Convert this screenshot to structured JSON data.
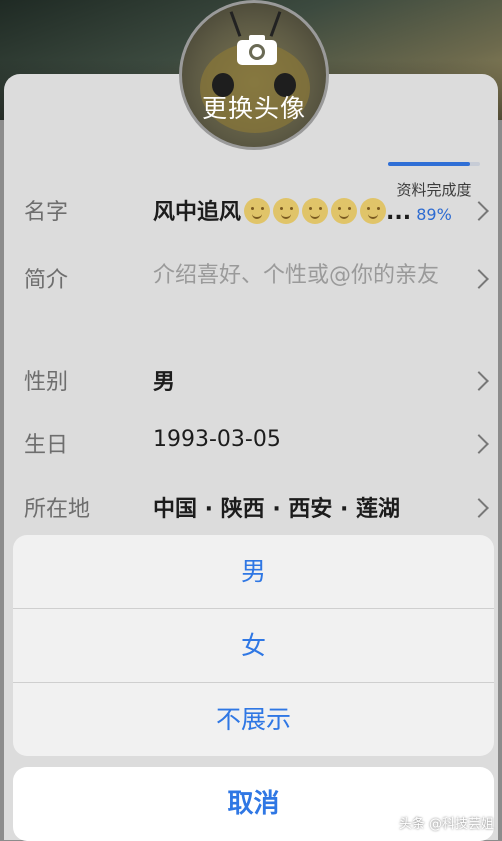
{
  "avatar": {
    "change_label": "更换头像",
    "camera_icon": "camera-icon"
  },
  "completion": {
    "label": "资料完成度",
    "value": "89%",
    "fraction": 0.89
  },
  "fields": [
    {
      "label": "名字",
      "value": "风中追风",
      "emoji_count": 5,
      "ellipsis": "..."
    },
    {
      "label": "简介",
      "placeholder": "介绍喜好、个性或@你的亲友"
    },
    {
      "label": "性别",
      "value": "男"
    },
    {
      "label": "生日",
      "value": "1993-03-05"
    },
    {
      "label": "所在地",
      "value": "中国 · 陕西 · 西安 · 莲湖"
    }
  ],
  "action_sheet": {
    "options": [
      "男",
      "女",
      "不展示"
    ],
    "cancel": "取消"
  },
  "watermark": "头条 @科技芸姐",
  "colors": {
    "accent": "#2f77e4",
    "progress": "#2f6fd6"
  }
}
